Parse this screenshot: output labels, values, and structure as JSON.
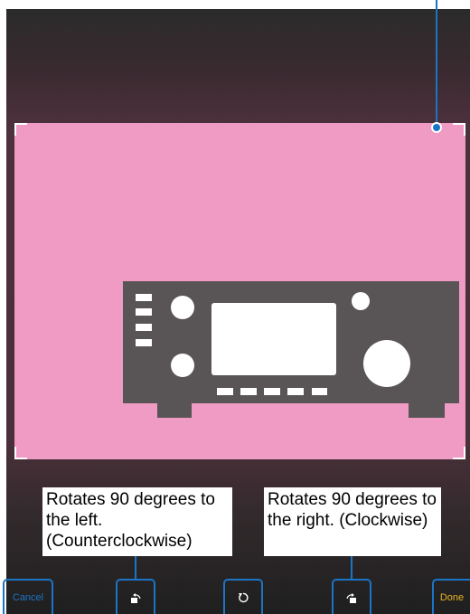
{
  "toolbar": {
    "cancel_label": "Cancel",
    "done_label": "Done",
    "cancel_color": "#1b74c5",
    "done_color": "#e7b220"
  },
  "notes": {
    "rotate_left": "Rotates 90 degrees to the left. (Counterclockwise)",
    "rotate_right": "Rotates 90 degrees to the right. (Clockwise)"
  },
  "icons": {
    "rotate_left": "rotate-left-icon",
    "reset": "reset-rotation-icon",
    "rotate_right": "rotate-right-icon"
  },
  "colors": {
    "crop_fill": "#ef9bc3",
    "callout": "#1b74c5",
    "radio": "#595456"
  }
}
